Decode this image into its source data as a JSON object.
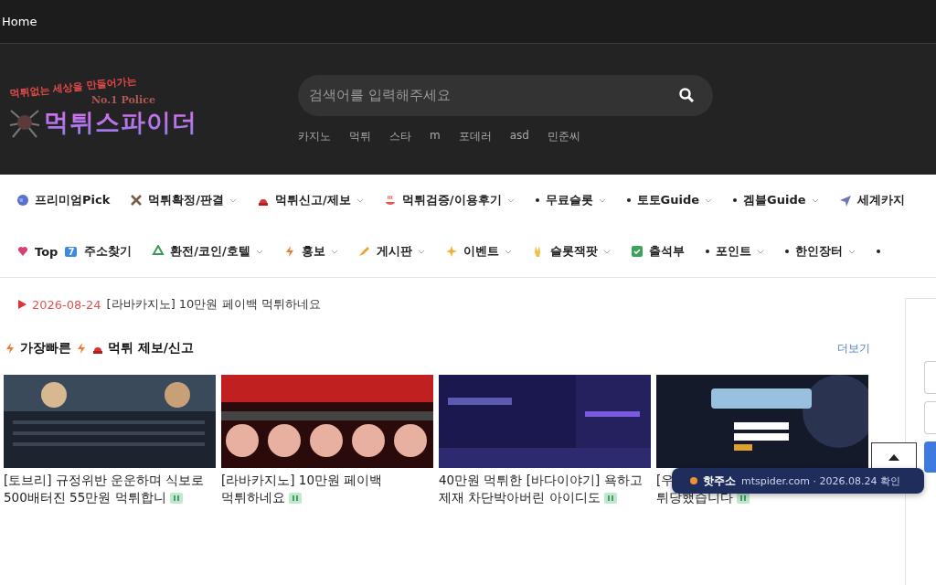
{
  "topbar": {
    "home": "Home"
  },
  "header": {
    "logo": {
      "tagline": "먹튀없는 세상을 만들어가는",
      "badge": "No.1 Police",
      "name": "먹튀스파이더"
    },
    "search": {
      "placeholder": "검색어를 입력해주세요"
    },
    "keywords": [
      "카지노",
      "먹튀",
      "스타",
      "m",
      "포데러",
      "asd",
      "민준씨"
    ]
  },
  "nav_rows": [
    [
      {
        "label": "프리미엄Pick",
        "kind": "globe",
        "dropdown": false
      },
      {
        "label": "먹튀확정/판결",
        "kind": "tools",
        "dropdown": true
      },
      {
        "label": "먹튀신고/제보",
        "kind": "siren",
        "dropdown": true
      },
      {
        "label": "먹튀검증/이용후기",
        "kind": "hotspring",
        "dropdown": true
      },
      {
        "label": "무료슬롯",
        "kind": "bullet",
        "dropdown": true
      },
      {
        "label": "토토Guide",
        "kind": "bullet",
        "dropdown": true
      },
      {
        "label": "겜블Guide",
        "kind": "bullet",
        "dropdown": true
      },
      {
        "label": "세계카지",
        "kind": "plane",
        "dropdown": false
      }
    ],
    [
      {
        "label": "Top",
        "kind": "heart",
        "badge": "7",
        "extra": "주소찾기",
        "dropdown": false
      },
      {
        "label": "환전/코인/호텔",
        "kind": "recycle",
        "dropdown": true
      },
      {
        "label": "홍보",
        "kind": "bolt",
        "dropdown": true
      },
      {
        "label": "게시판",
        "kind": "pen",
        "dropdown": true
      },
      {
        "label": "이벤트",
        "kind": "sparkle",
        "dropdown": true
      },
      {
        "label": "슬롯잭팟",
        "kind": "hand",
        "dropdown": true
      },
      {
        "label": "출석부",
        "kind": "check",
        "dropdown": false
      },
      {
        "label": "포인트",
        "kind": "bullet",
        "dropdown": true
      },
      {
        "label": "한인장터",
        "kind": "bullet",
        "dropdown": true
      },
      {
        "kind": "bullet",
        "dropdown": false
      }
    ]
  ],
  "ticker": {
    "date": "2026-08-24",
    "text": "[라바카지노] 10만원 페이백 먹튀하네요"
  },
  "section": {
    "title_parts": [
      "가장빠른",
      "먹튀 제보/신고"
    ],
    "more": "더보기"
  },
  "cards": [
    {
      "title": "[토브리] 규정위반 운운하며 식보로 500배터진 55만원 먹튀합니"
    },
    {
      "title": "[라바카지노] 10만원 페이백 먹튀하네요"
    },
    {
      "title": "40만원 먹튀한 [바다이야기] 욕하고 제재 차단박아버린 아이디도"
    },
    {
      "title": "[우",
      "line2": "튀당했습니다"
    }
  ],
  "toast": {
    "label": "핫주소",
    "domain": "mtspider.com",
    "separator": "·",
    "date": "2026.08.24 확인"
  }
}
